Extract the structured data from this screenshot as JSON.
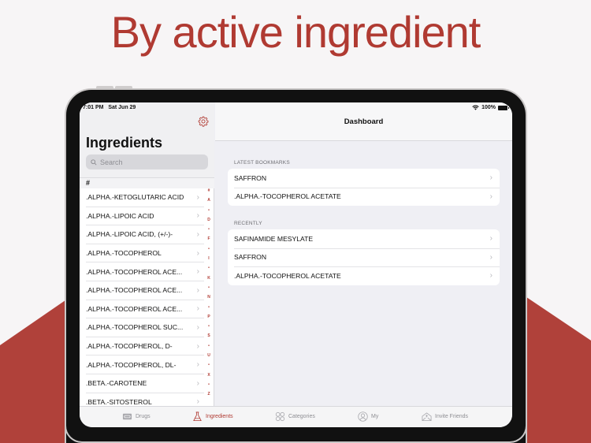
{
  "headline": "By active ingredient",
  "colors": {
    "accent": "#b03a32",
    "background": "#f7f5f6"
  },
  "status_bar": {
    "time": "7:01 PM",
    "date": "Sat Jun 29",
    "battery": "100%",
    "wifi_icon": "wifi-icon",
    "battery_icon": "battery-icon"
  },
  "sidebar": {
    "title": "Ingredients",
    "settings_icon": "gear-icon",
    "search": {
      "placeholder": "Search",
      "value": ""
    },
    "section_header": "#",
    "items": [
      {
        "label": ".ALPHA.-KETOGLUTARIC ACID"
      },
      {
        "label": ".ALPHA.-LIPOIC ACID"
      },
      {
        "label": ".ALPHA.-LIPOIC ACID, (+/-)-"
      },
      {
        "label": ".ALPHA.-TOCOPHEROL"
      },
      {
        "label": ".ALPHA.-TOCOPHEROL ACE..."
      },
      {
        "label": ".ALPHA.-TOCOPHEROL ACE..."
      },
      {
        "label": ".ALPHA.-TOCOPHEROL ACE..."
      },
      {
        "label": ".ALPHA.-TOCOPHEROL SUC..."
      },
      {
        "label": ".ALPHA.-TOCOPHEROL, D-"
      },
      {
        "label": ".ALPHA.-TOCOPHEROL, DL-"
      },
      {
        "label": ".BETA.-CAROTENE"
      },
      {
        "label": ".BETA.-SITOSTEROL"
      }
    ],
    "index": [
      "#",
      "A",
      "•",
      "D",
      "•",
      "F",
      "•",
      "I",
      "•",
      "K",
      "•",
      "N",
      "•",
      "P",
      "•",
      "S",
      "•",
      "U",
      "•",
      "X",
      "•",
      "Z"
    ]
  },
  "detail": {
    "title": "Dashboard",
    "bookmarks": {
      "header": "LATEST BOOKMARKS",
      "items": [
        {
          "label": "SAFFRON"
        },
        {
          "label": ".ALPHA.-TOCOPHEROL ACETATE"
        }
      ]
    },
    "recent": {
      "header": "RECENTLY",
      "items": [
        {
          "label": "SAFINAMIDE MESYLATE"
        },
        {
          "label": "SAFFRON"
        },
        {
          "label": ".ALPHA.-TOCOPHEROL ACETATE"
        }
      ]
    }
  },
  "tabbar": {
    "tabs": [
      {
        "label": "Drugs",
        "icon": "pill-box-icon",
        "active": false
      },
      {
        "label": "Ingredients",
        "icon": "flask-icon",
        "active": true
      },
      {
        "label": "Categories",
        "icon": "categories-icon",
        "active": false
      },
      {
        "label": "My",
        "icon": "person-icon",
        "active": false
      },
      {
        "label": "Invite Friends",
        "icon": "invite-envelope-icon",
        "active": false
      }
    ]
  }
}
